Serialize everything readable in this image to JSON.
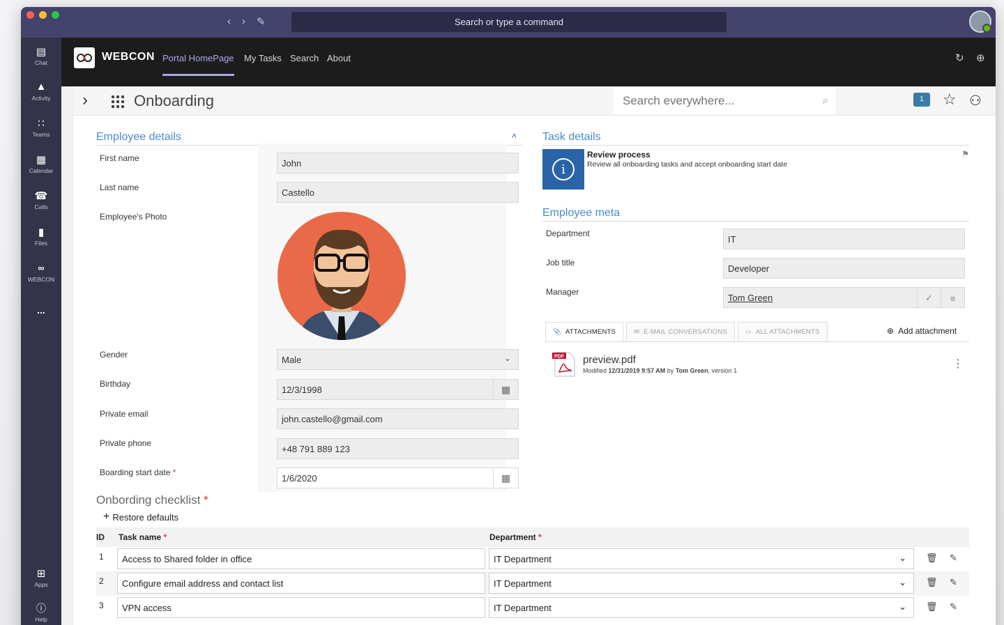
{
  "titlebar": {
    "command_placeholder": "Search or type a command",
    "window_buttons": [
      "#ff5f57",
      "#febc2e",
      "#28c840"
    ]
  },
  "rail": {
    "items": [
      {
        "label": "Chat",
        "icon": "chat-icon"
      },
      {
        "label": "Activity",
        "icon": "bell-icon"
      },
      {
        "label": "Teams",
        "icon": "teams-icon"
      },
      {
        "label": "Calendar",
        "icon": "calendar-icon"
      },
      {
        "label": "Calls",
        "icon": "phone-icon"
      },
      {
        "label": "Files",
        "icon": "file-icon"
      },
      {
        "label": "WEBCON",
        "icon": "webcon-icon"
      },
      {
        "label": "...",
        "icon": "more-icon"
      },
      {
        "label": "Apps",
        "icon": "apps-icon"
      },
      {
        "label": "Help",
        "icon": "help-icon"
      }
    ]
  },
  "appbar": {
    "brand": "WEBCON",
    "tabs": [
      "Portal HomePage",
      "My Tasks",
      "Search",
      "About"
    ],
    "active_tab": "Portal HomePage"
  },
  "pagebar": {
    "title": "Onboarding",
    "search_placeholder": "Search everywhere...",
    "notification_count": "1"
  },
  "employee_details": {
    "title": "Employee details",
    "fields": {
      "first_name_label": "First name",
      "first_name": "John",
      "last_name_label": "Last name",
      "last_name": "Castello",
      "photo_label": "Employee's Photo",
      "gender_label": "Gender",
      "gender": "Male",
      "birthday_label": "Birthday",
      "birthday": "12/3/1998",
      "email_label": "Private email",
      "email": "john.castello@gmail.com",
      "phone_label": "Private phone",
      "phone": "+48 791 889 123",
      "start_label": "Boarding start date",
      "start_date": "1/6/2020",
      "required_mark": "*"
    }
  },
  "task_details": {
    "title": "Task details",
    "task_name": "Review process",
    "task_desc": "Review all onboarding tasks and accept onboarding start date"
  },
  "employee_meta": {
    "title": "Employee meta",
    "department_label": "Department",
    "department": "IT",
    "job_label": "Job title",
    "job": "Developer",
    "manager_label": "Manager",
    "manager": "Tom Green"
  },
  "attachments": {
    "tabs": [
      "ATTACHMENTS",
      "E-MAIL CONVERSATIONS",
      "ALL ATTACHMENTS"
    ],
    "add_label": "Add attachment",
    "file": {
      "name": "preview.pdf",
      "meta_prefix": "Modified",
      "date": "12/31/2019 9:57 AM",
      "by": "by",
      "author": "Tom Green",
      "version": ", version 1",
      "pdf_badge": "PDF"
    }
  },
  "checklist": {
    "title": "Onbording checklist",
    "restore_label": "Restore defaults",
    "columns": [
      "ID",
      "Task name",
      "Department"
    ],
    "rows": [
      {
        "id": "1",
        "task": "Access to Shared folder in office",
        "dept": "IT Department"
      },
      {
        "id": "2",
        "task": "Configure email address and contact list",
        "dept": "IT Department"
      },
      {
        "id": "3",
        "task": "VPN access",
        "dept": "IT Department"
      }
    ]
  },
  "colors": {
    "titlebar": "#44436b",
    "rail": "#33344a",
    "accent": "#4a8bd1",
    "task_icon": "#2a63a8"
  }
}
